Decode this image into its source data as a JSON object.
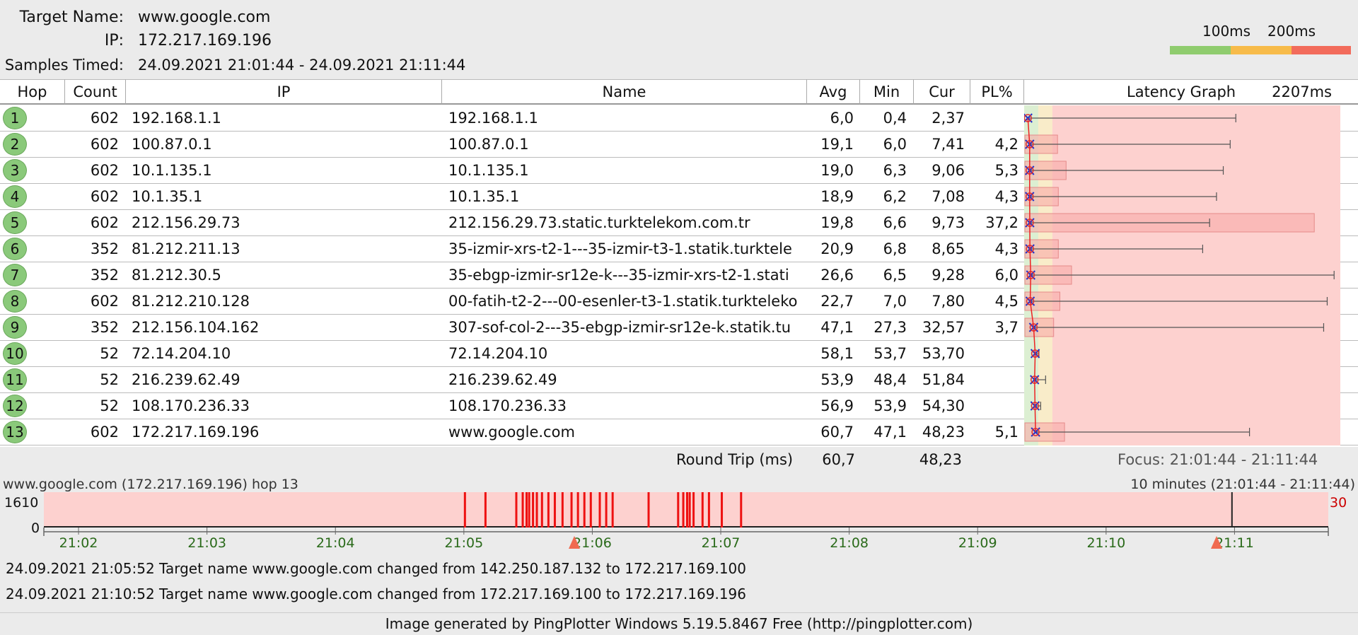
{
  "header": {
    "target_label": "Target Name:",
    "target_value": "www.google.com",
    "ip_label": "IP:",
    "ip_value": "172.217.169.196",
    "samples_label": "Samples Timed:",
    "samples_value": "24.09.2021 21:01:44 - 24.09.2021 21:11:44"
  },
  "scale": {
    "label_100": "100ms",
    "label_200": "200ms",
    "colors": [
      "#8fcc6e",
      "#f7bb4a",
      "#f26b5b"
    ]
  },
  "columns": {
    "hop": "Hop",
    "count": "Count",
    "ip": "IP",
    "name": "Name",
    "avg": "Avg",
    "min": "Min",
    "cur": "Cur",
    "pl": "PL%",
    "graph": "Latency Graph",
    "graph_max": "2207ms"
  },
  "graph_scale_max_ms": 2207,
  "hops": [
    {
      "hop": "1",
      "count": "602",
      "ip": "192.168.1.1",
      "name": "192.168.1.1",
      "avg": "6,0",
      "min": "0,4",
      "cur": "2,37",
      "pl": "",
      "max_ms": 1481,
      "pl_value": 0
    },
    {
      "hop": "2",
      "count": "602",
      "ip": "100.87.0.1",
      "name": "100.87.0.1",
      "avg": "19,1",
      "min": "6,0",
      "cur": "7,41",
      "pl": "4,2",
      "max_ms": 1441,
      "pl_value": 4.2
    },
    {
      "hop": "3",
      "count": "602",
      "ip": "10.1.135.1",
      "name": "10.1.135.1",
      "avg": "19,0",
      "min": "6,3",
      "cur": "9,06",
      "pl": "5,3",
      "max_ms": 1392,
      "pl_value": 5.3
    },
    {
      "hop": "4",
      "count": "602",
      "ip": "10.1.35.1",
      "name": "10.1.35.1",
      "avg": "18,9",
      "min": "6,2",
      "cur": "7,08",
      "pl": "4,3",
      "max_ms": 1344,
      "pl_value": 4.3
    },
    {
      "hop": "5",
      "count": "602",
      "ip": "212.156.29.73",
      "name": "212.156.29.73.static.turktelekom.com.tr",
      "avg": "19,8",
      "min": "6,6",
      "cur": "9,73",
      "pl": "37,2",
      "max_ms": 1295,
      "pl_value": 37.2
    },
    {
      "hop": "6",
      "count": "352",
      "ip": "81.212.211.13",
      "name": "35-izmir-xrs-t2-1---35-izmir-t3-1.statik.turktele",
      "avg": "20,9",
      "min": "6,8",
      "cur": "8,65",
      "pl": "4,3",
      "max_ms": 1246,
      "pl_value": 4.3
    },
    {
      "hop": "7",
      "count": "352",
      "ip": "81.212.30.5",
      "name": "35-ebgp-izmir-sr12e-k---35-izmir-xrs-t2-1.stati",
      "avg": "26,6",
      "min": "6,5",
      "cur": "9,28",
      "pl": "6,0",
      "max_ms": 2178,
      "pl_value": 6.0
    },
    {
      "hop": "8",
      "count": "602",
      "ip": "81.212.210.128",
      "name": "00-fatih-t2-2---00-esenler-t3-1.statik.turkteleko",
      "avg": "22,7",
      "min": "7,0",
      "cur": "7,80",
      "pl": "4,5",
      "max_ms": 2129,
      "pl_value": 4.5
    },
    {
      "hop": "9",
      "count": "352",
      "ip": "212.156.104.162",
      "name": "307-sof-col-2---35-ebgp-izmir-sr12e-k.statik.tu",
      "avg": "47,1",
      "min": "27,3",
      "cur": "32,57",
      "pl": "3,7",
      "max_ms": 2104,
      "pl_value": 3.7
    },
    {
      "hop": "10",
      "count": "52",
      "ip": "72.14.204.10",
      "name": "72.14.204.10",
      "avg": "58,1",
      "min": "53,7",
      "cur": "53,70",
      "pl": "",
      "max_ms": 85,
      "pl_value": 0
    },
    {
      "hop": "11",
      "count": "52",
      "ip": "216.239.62.49",
      "name": "216.239.62.49",
      "avg": "53,9",
      "min": "48,4",
      "cur": "51,84",
      "pl": "",
      "max_ms": 132,
      "pl_value": 0
    },
    {
      "hop": "12",
      "count": "52",
      "ip": "108.170.236.33",
      "name": "108.170.236.33",
      "avg": "56,9",
      "min": "53,9",
      "cur": "54,30",
      "pl": "",
      "max_ms": 97,
      "pl_value": 0
    },
    {
      "hop": "13",
      "count": "602",
      "ip": "172.217.169.196",
      "name": "www.google.com",
      "avg": "60,7",
      "min": "47,1",
      "cur": "48,23",
      "pl": "5,1",
      "max_ms": 1578,
      "pl_value": 5.1
    }
  ],
  "summary": {
    "label": "Round Trip (ms)",
    "avg": "60,7",
    "cur": "48,23",
    "focus": "Focus: 21:01:44 - 21:11:44"
  },
  "timeline": {
    "title_left": "www.google.com (172.217.169.196) hop 13",
    "title_right": "10 minutes (21:01:44 - 21:11:44)",
    "y_max": "1610",
    "y_min": "0",
    "right_value": "30",
    "ticks": [
      "21:02",
      "21:03",
      "21:04",
      "21:05",
      "21:06",
      "21:07",
      "21:08",
      "21:09",
      "21:10",
      "21:11"
    ],
    "loss_events_min": [
      3.27,
      3.43,
      3.67,
      3.72,
      3.75,
      3.77,
      3.8,
      3.83,
      3.87,
      3.92,
      3.97,
      4.03,
      4.1,
      4.15,
      4.2,
      4.25,
      4.32,
      4.37,
      4.42,
      4.7,
      4.93,
      4.97,
      5.0,
      5.02,
      5.05,
      5.12,
      5.17,
      5.27,
      5.42
    ]
  },
  "events": [
    "24.09.2021 21:05:52 Target name www.google.com changed from 142.250.187.132 to 172.217.169.100",
    "24.09.2021 21:10:52 Target name www.google.com changed from 172.217.169.100 to 172.217.169.196"
  ],
  "footer": "Image generated by PingPlotter Windows 5.19.5.8467 Free (http://pingplotter.com)"
}
